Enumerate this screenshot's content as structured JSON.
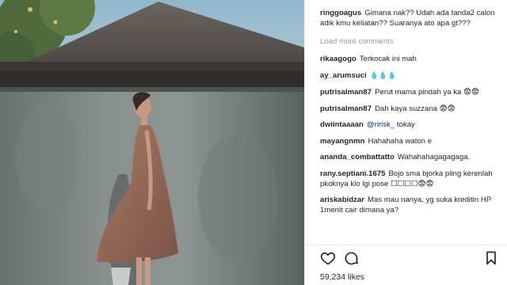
{
  "post": {
    "caption": {
      "user": "ringgoagus",
      "text": "Gimana nak?? Udah ada tanda2 calon adik kmu keliatan?? Suaranya ato apa gt???"
    },
    "load_more_label": "Load more comments",
    "comments": [
      {
        "user": "rikaagogo",
        "text": "Terkocak ini mah"
      },
      {
        "user": "ay_arumsuci",
        "text": "💧💧💧"
      },
      {
        "user": "putrisalman87",
        "text": "Perut mama pindah ya ka 😨😨"
      },
      {
        "user": "putrisalman87",
        "text": "Dah kaya suzzana 😨😨"
      },
      {
        "user": "dwiintaaaan",
        "mention": "@ririsk_",
        "text": "tokay"
      },
      {
        "user": "mayangnmn",
        "text": "Hahahaha waton e"
      },
      {
        "user": "ananda_combattatto",
        "text": "Wahahahagagagaga."
      },
      {
        "user": "rany.septiani.1675",
        "text": "Bojo sma bjorka pling kerenlah pkoknya klo lgi pose ☐☐☐☐😨😨"
      },
      {
        "user": "ariskabidzar",
        "text": "Mas mau nanya, yg suka kreditin HP 1menit cair dimana ya?"
      }
    ],
    "likes": "59,234 likes",
    "icons": {
      "like": "heart-icon",
      "comment": "comment-icon",
      "save": "bookmark-icon"
    },
    "colors": {
      "text": "#262626",
      "muted": "#999999",
      "mention": "#003569"
    }
  }
}
